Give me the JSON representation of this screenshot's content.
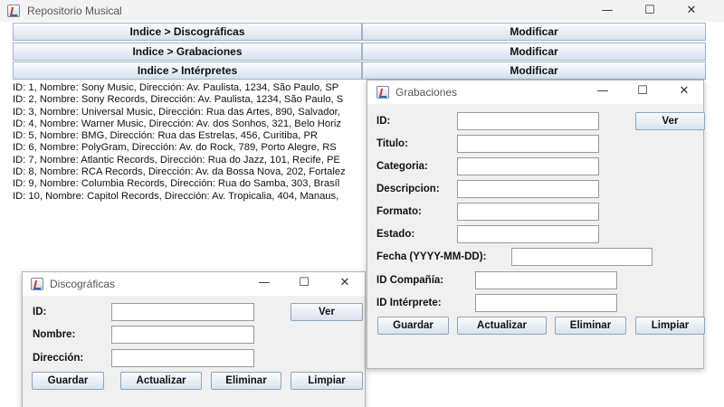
{
  "main_window": {
    "title": "Repositorio Musical",
    "controls": {
      "minimize": "—",
      "maximize": "☐",
      "close": "✕"
    },
    "menu": [
      {
        "label": "Indice > Discográficas",
        "action": "Modificar"
      },
      {
        "label": "Indice > Grabaciones",
        "action": "Modificar"
      },
      {
        "label": "Indice > Intérpretes",
        "action": "Modificar"
      }
    ],
    "records": [
      "ID: 1, Nombre: Sony Music, Dirección: Av. Paulista, 1234, São Paulo, SP",
      "ID: 2, Nombre: Sony Records, Dirección: Av. Paulista, 1234, São Paulo, S",
      "ID: 3, Nombre: Universal Music, Dirección: Rua das Artes, 890, Salvador,",
      "ID: 4, Nombre: Warner Music, Dirección: Av. dos Sonhos, 321, Belo Horiz",
      "ID: 5, Nombre: BMG, Dirección: Rua das Estrelas, 456, Curitiba, PR",
      "ID: 6, Nombre: PolyGram, Dirección: Av. do Rock, 789, Porto Alegre, RS",
      "ID: 7, Nombre: Atlantic Records, Dirección: Rua do Jazz, 101, Recife, PE",
      "ID: 8, Nombre: RCA Records, Dirección: Av. da Bossa Nova, 202, Fortalez",
      "ID: 9, Nombre: Columbia Records, Dirección: Rua do Samba, 303, Brasíl",
      "ID: 10, Nombre: Capitol Records, Dirección: Av. Tropicalia, 404, Manaus,"
    ]
  },
  "discograficas": {
    "title": "Discográficas",
    "controls": {
      "minimize": "—",
      "maximize": "☐",
      "close": "✕"
    },
    "labels": {
      "id": "ID:",
      "nombre": "Nombre:",
      "direccion": "Dirección:"
    },
    "values": {
      "id": "",
      "nombre": "",
      "direccion": ""
    },
    "buttons": {
      "ver": "Ver",
      "guardar": "Guardar",
      "actualizar": "Actualizar",
      "eliminar": "Eliminar",
      "limpiar": "Limpiar"
    }
  },
  "grabaciones": {
    "title": "Grabaciones",
    "controls": {
      "minimize": "—",
      "maximize": "☐",
      "close": "✕"
    },
    "labels": {
      "id": "ID:",
      "titulo": "Titulo:",
      "categoria": "Categoria:",
      "descripcion": "Descripcion:",
      "formato": "Formato:",
      "estado": "Estado:",
      "fecha": "Fecha (YYYY-MM-DD):",
      "id_compania": "ID Compañía:",
      "id_interprete": "ID Intérprete:"
    },
    "values": {
      "id": "",
      "titulo": "",
      "categoria": "",
      "descripcion": "",
      "formato": "",
      "estado": "",
      "fecha": "",
      "id_compania": "",
      "id_interprete": ""
    },
    "buttons": {
      "ver": "Ver",
      "guardar": "Guardar",
      "actualizar": "Actualizar",
      "eliminar": "Eliminar",
      "limpiar": "Limpiar"
    }
  }
}
